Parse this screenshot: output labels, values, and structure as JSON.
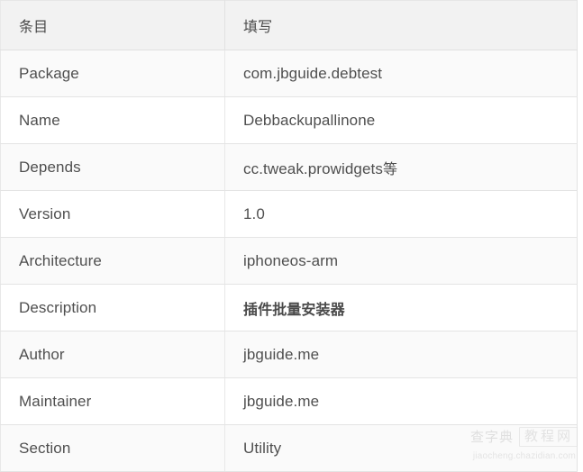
{
  "table": {
    "headers": {
      "item": "条目",
      "value": "填写"
    },
    "rows": [
      {
        "item": "Package",
        "value": "com.jbguide.debtest"
      },
      {
        "item": "Name",
        "value": "Debbackupallinone"
      },
      {
        "item": "Depends",
        "value": "cc.tweak.prowidgets等"
      },
      {
        "item": "Version",
        "value": "1.0"
      },
      {
        "item": "Architecture",
        "value": "iphoneos-arm"
      },
      {
        "item": "Description",
        "value": "插件批量安装器"
      },
      {
        "item": "Author",
        "value": "jbguide.me"
      },
      {
        "item": "Maintainer",
        "value": "jbguide.me"
      },
      {
        "item": "Section",
        "value": "Utility"
      }
    ]
  },
  "watermark": {
    "brand_left": "查字典",
    "brand_right": "教程网",
    "url": "jiaocheng.chazidian.com"
  },
  "colors": {
    "header_bg": "#f2f2f2",
    "row_odd_bg": "#fafafa",
    "row_even_bg": "#ffffff",
    "border": "#e4e4e4",
    "text": "#4f4f4f",
    "watermark_text": "#cfcfcf"
  }
}
